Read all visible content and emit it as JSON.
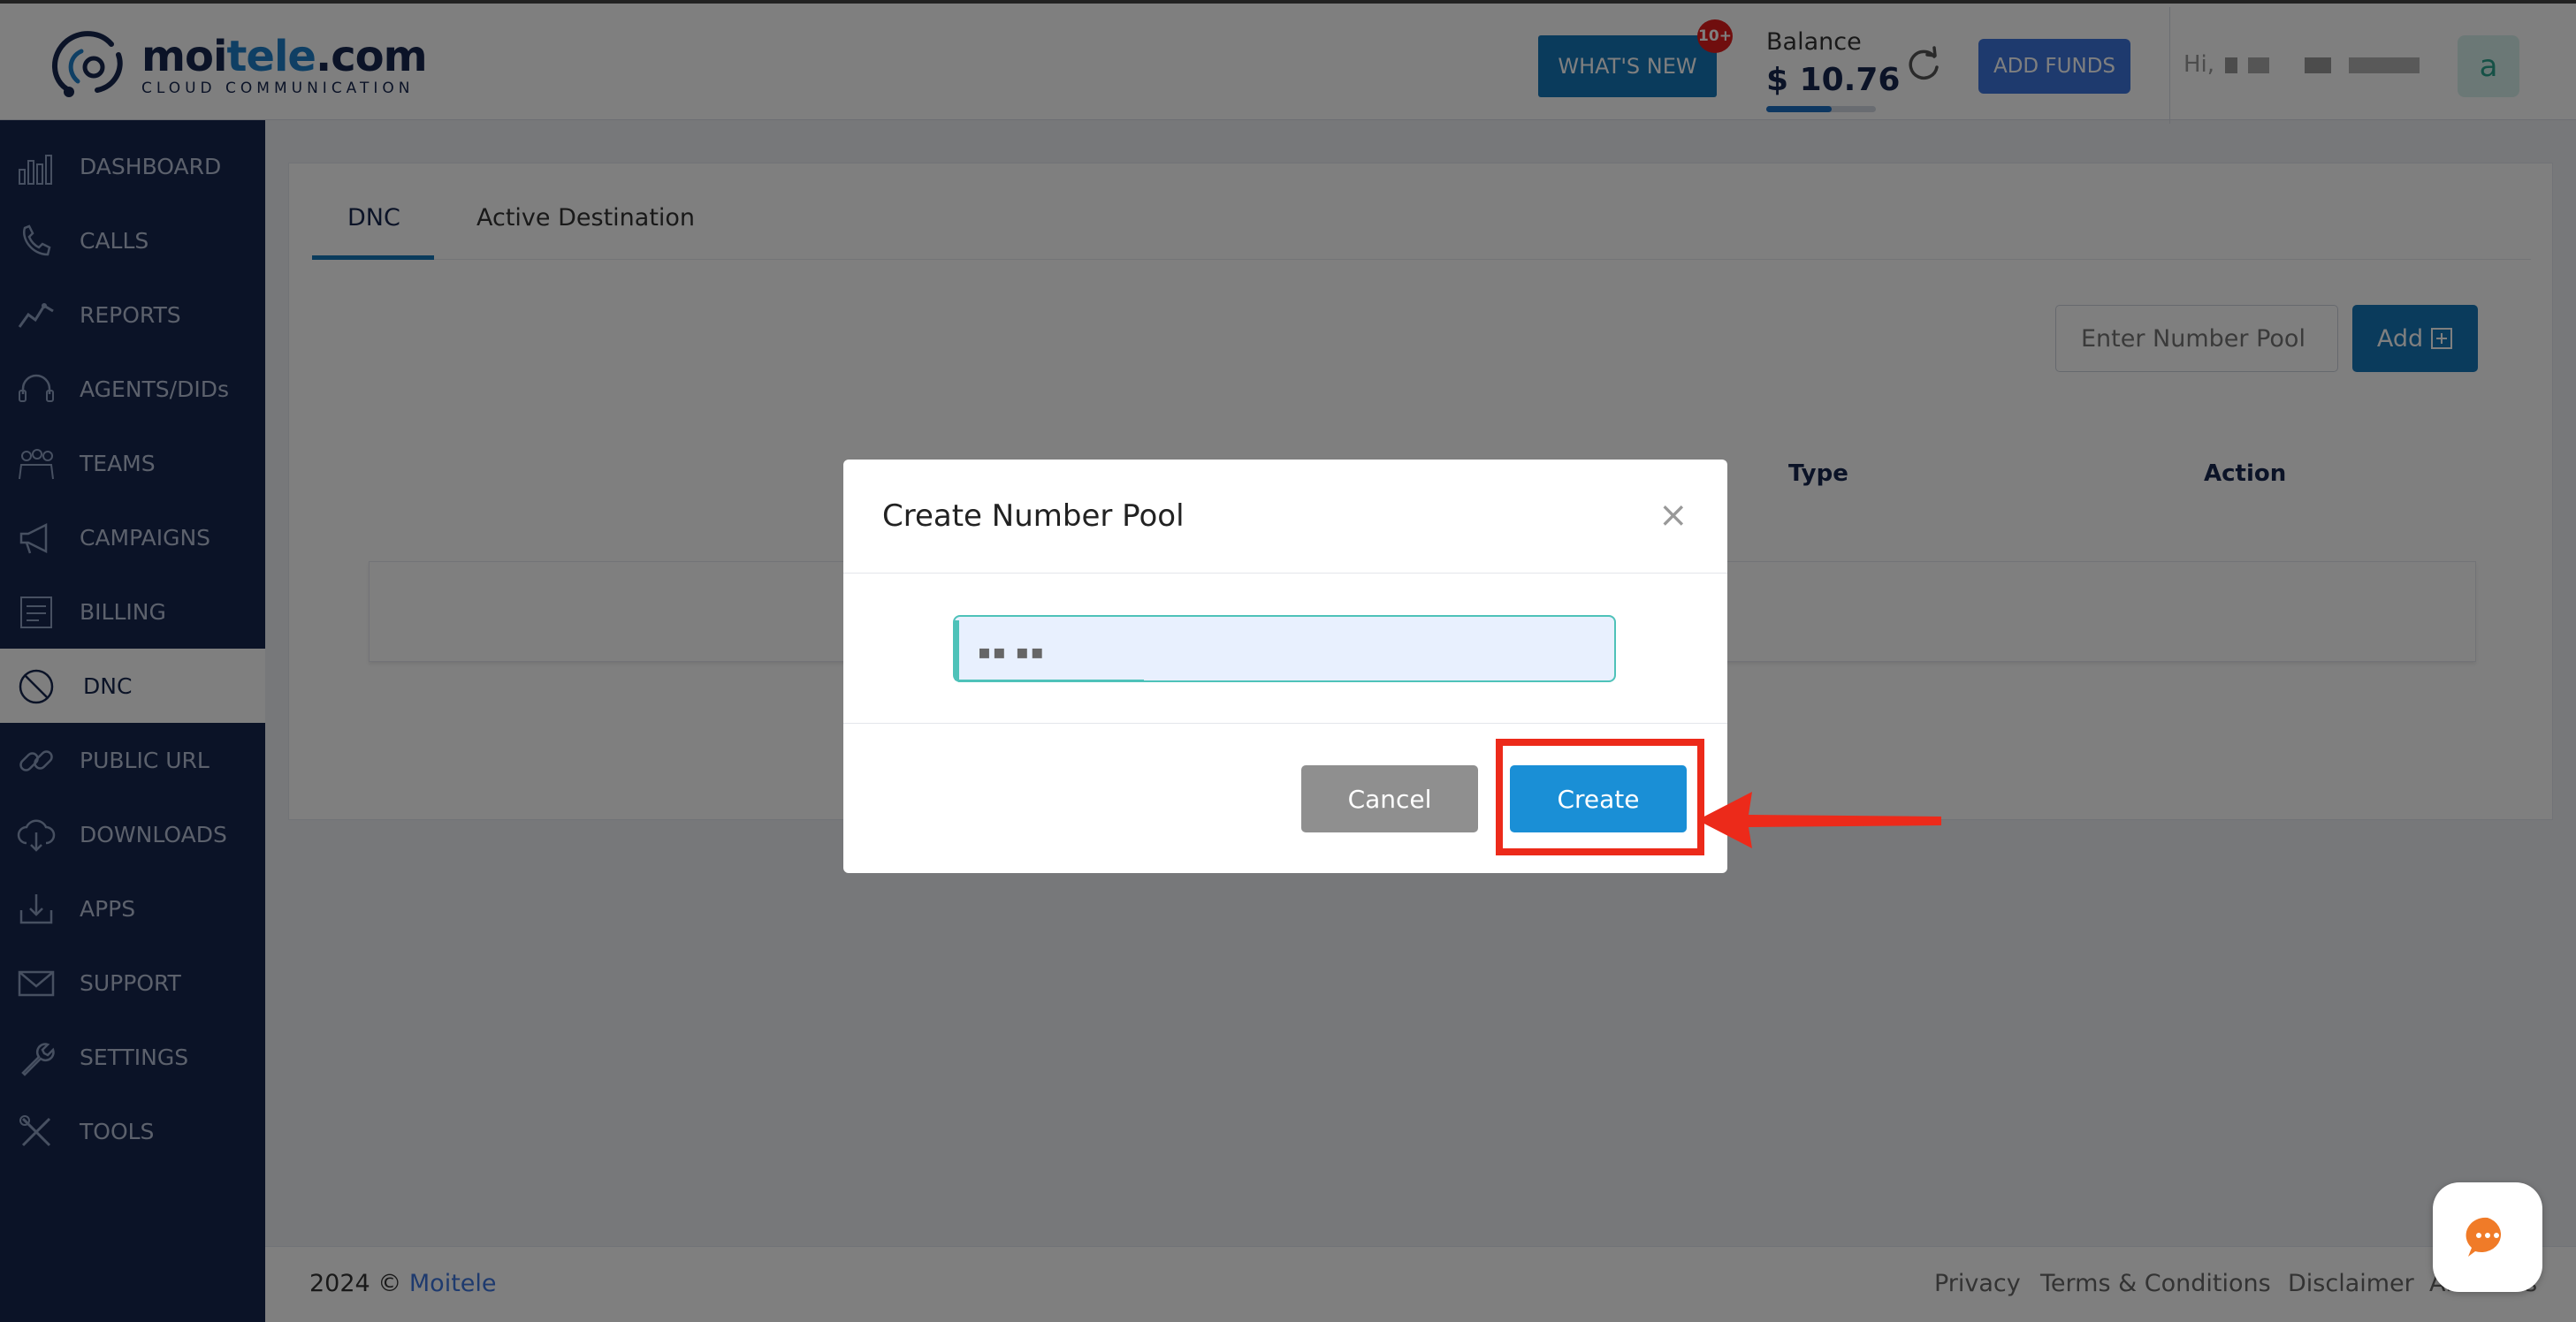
{
  "header": {
    "logo_name_part1": "moi",
    "logo_name_part2": "tele",
    "logo_name_part3": ".com",
    "logo_tagline": "CLOUD COMMUNICATION",
    "whats_new_label": "WHAT'S NEW",
    "whats_new_badge": "10+",
    "balance_label": "Balance",
    "balance_value": "$ 10.76",
    "balance_progress_fraction": 0.6,
    "add_funds_label": "ADD FUNDS",
    "greeting": "Hi,",
    "avatar_initial": "a"
  },
  "sidebar": {
    "items": [
      {
        "label": "DASHBOARD",
        "icon": "dashboard-icon"
      },
      {
        "label": "CALLS",
        "icon": "phone-icon"
      },
      {
        "label": "REPORTS",
        "icon": "chart-icon"
      },
      {
        "label": "AGENTS/DIDs",
        "icon": "headset-icon"
      },
      {
        "label": "TEAMS",
        "icon": "team-icon"
      },
      {
        "label": "CAMPAIGNS",
        "icon": "megaphone-icon"
      },
      {
        "label": "BILLING",
        "icon": "billing-icon"
      },
      {
        "label": "DNC",
        "icon": "block-icon",
        "active": true
      },
      {
        "label": "PUBLIC URL",
        "icon": "link-icon"
      },
      {
        "label": "DOWNLOADS",
        "icon": "cloud-download-icon"
      },
      {
        "label": "APPS",
        "icon": "apps-download-icon"
      },
      {
        "label": "SUPPORT",
        "icon": "mail-icon"
      },
      {
        "label": "SETTINGS",
        "icon": "wrench-icon"
      },
      {
        "label": "TOOLS",
        "icon": "tools-icon"
      }
    ]
  },
  "main": {
    "tabs": [
      {
        "label": "DNC",
        "active": true
      },
      {
        "label": "Active Destination",
        "active": false
      }
    ],
    "pool_input_placeholder": "Enter Number Pool",
    "add_button_label": "Add",
    "table_headers": [
      "Type",
      "Action"
    ]
  },
  "modal": {
    "title": "Create Number Pool",
    "close_symbol": "×",
    "input_value": "▪▪ ▪▪",
    "cancel_label": "Cancel",
    "create_label": "Create"
  },
  "footer": {
    "copyright": "2024 ©",
    "brand": "Moitele",
    "links": [
      "Privacy",
      "Terms & Conditions",
      "Disclaimer",
      "About Us"
    ]
  },
  "colors": {
    "sidebar_bg": "#16264f",
    "primary": "#1576b8",
    "create_button": "#1a8fd6",
    "annotation": "#ec2a1a"
  }
}
